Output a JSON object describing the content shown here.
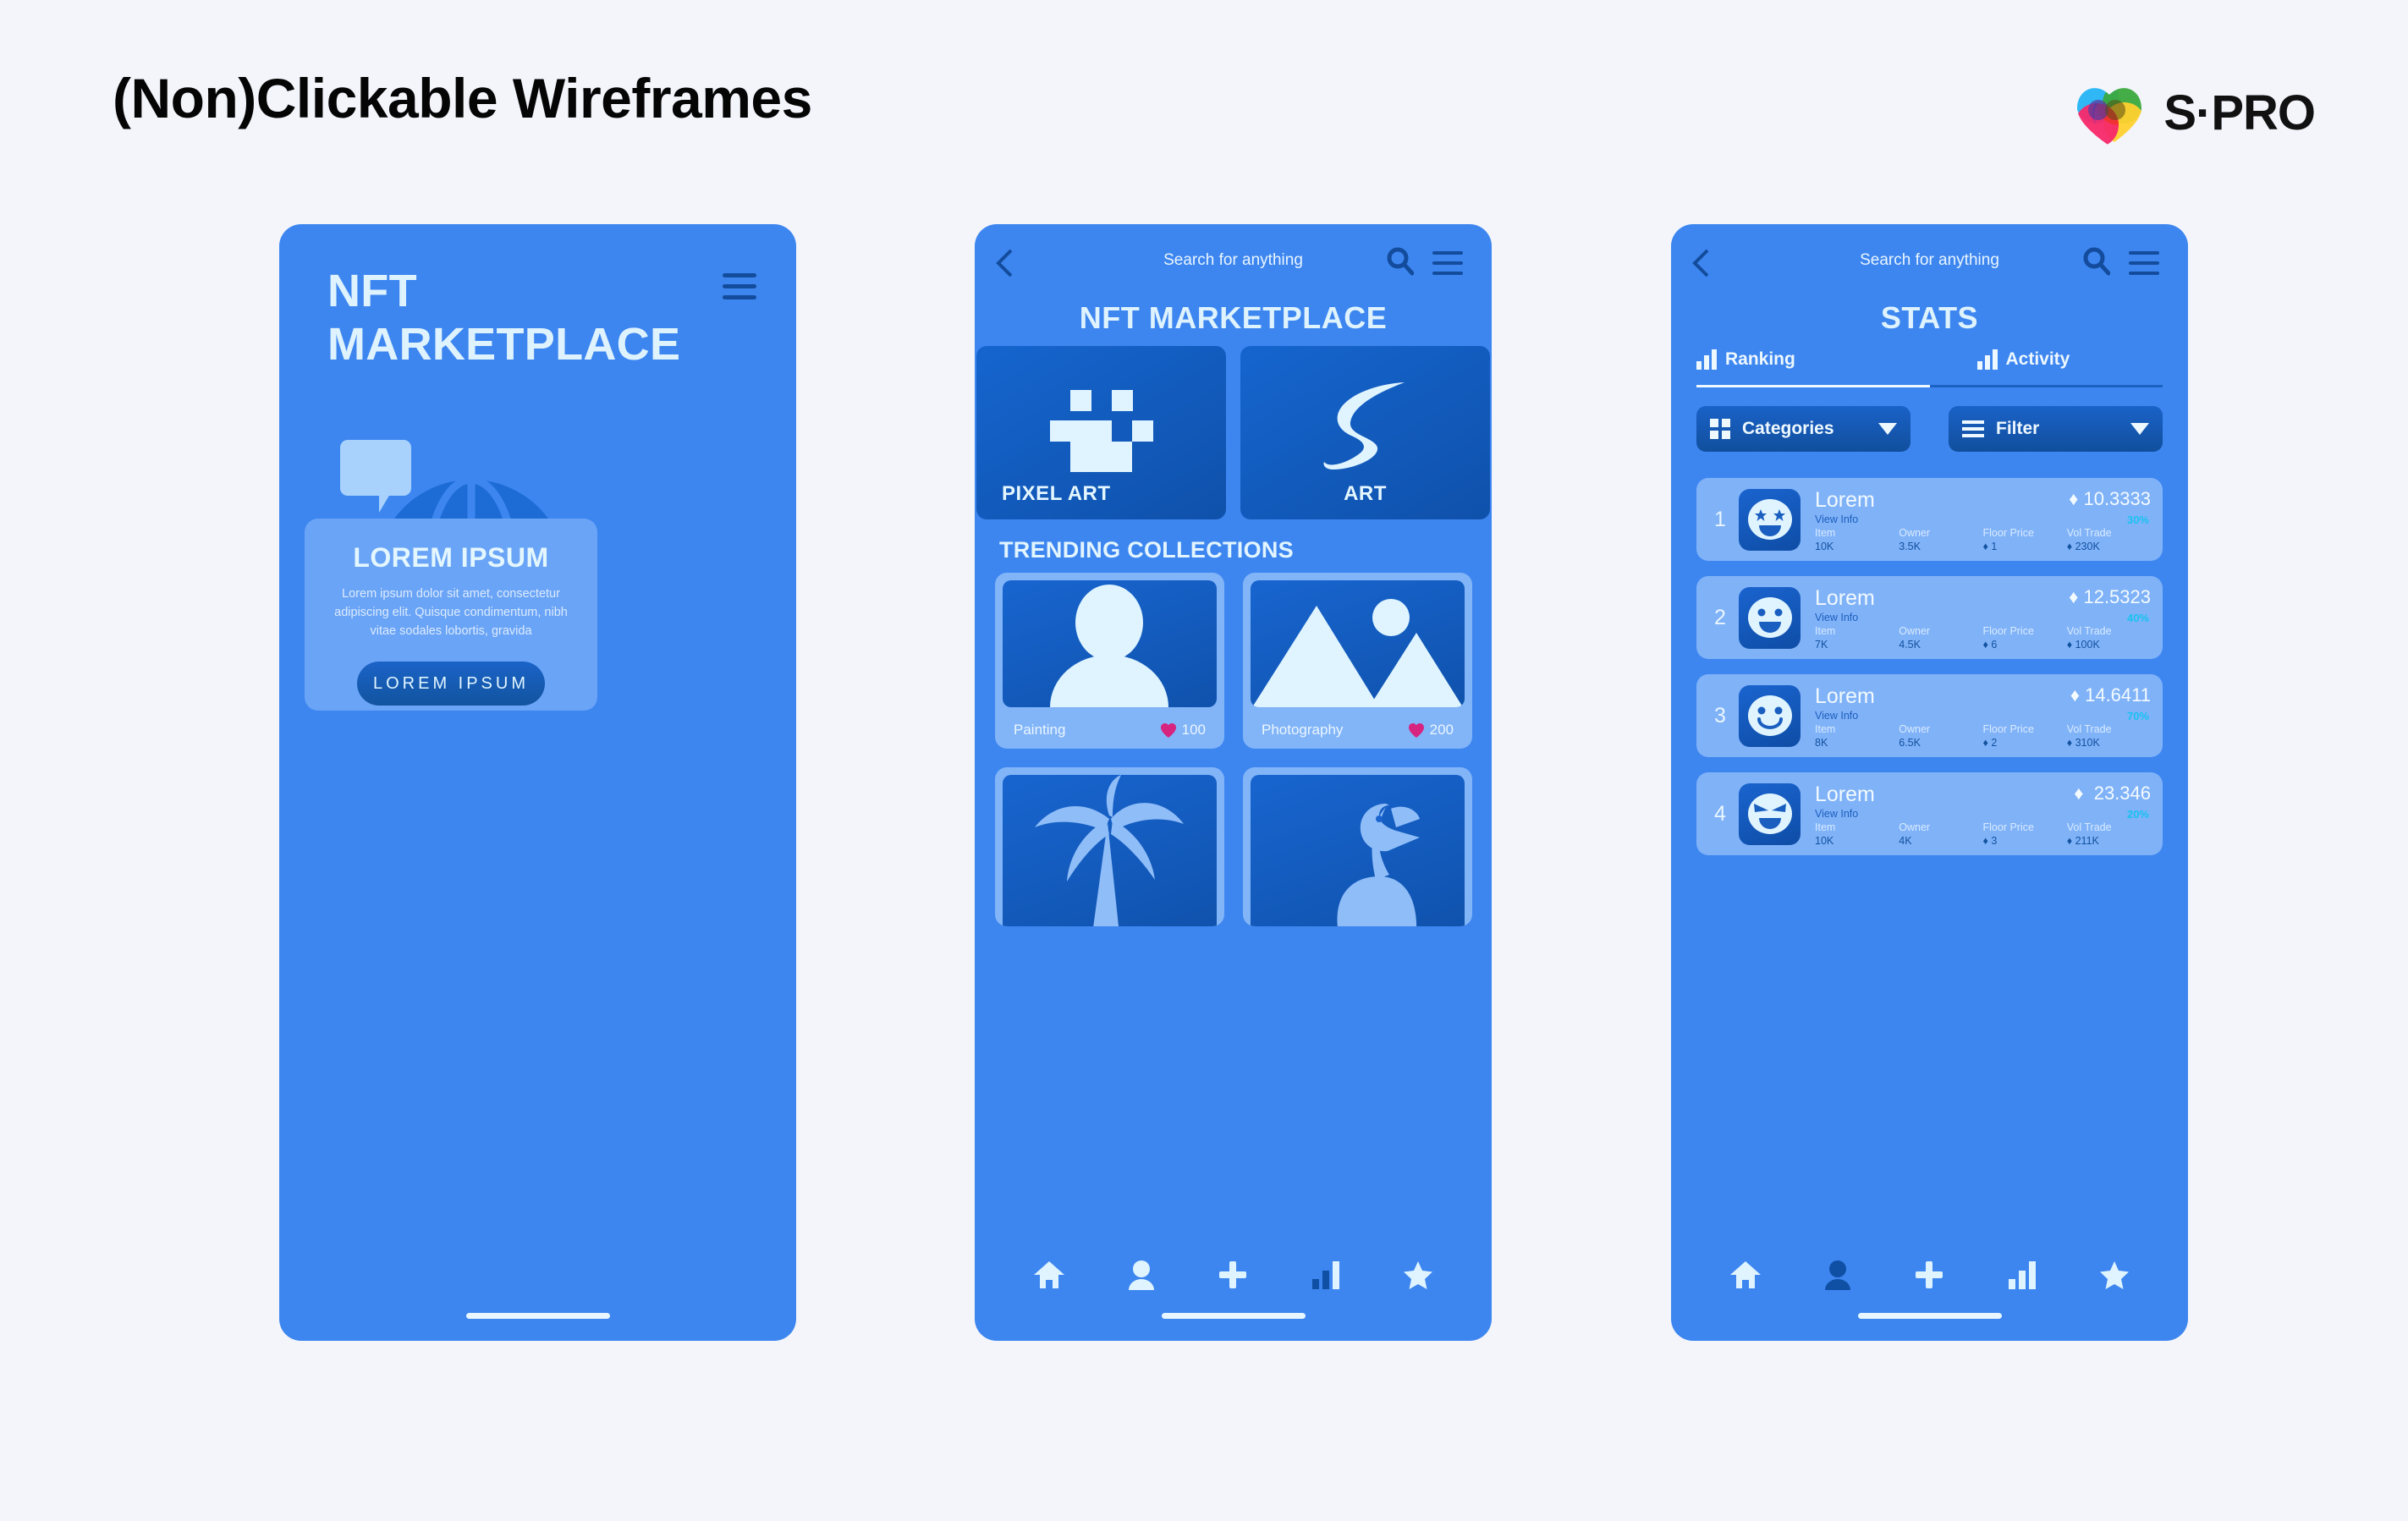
{
  "header": {
    "title": "(Non)Clickable Wireframes",
    "brand_name": "S·PRO",
    "brand_colors": {
      "blue": "#2fb8f5",
      "green": "#3aa93d",
      "yellow": "#ffd12e",
      "pink": "#f7286a",
      "red": "#f0322a",
      "purple": "#5b3a9b"
    }
  },
  "theme": {
    "page_bg": "#f4f5fb",
    "phone_bg": "#3d86f0",
    "tile_dark": "#1565cf",
    "text_light": "#dff3fe",
    "accent_dark": "#12529f",
    "accent_cyan": "#18c2f0",
    "heart_pink": "#d6247f"
  },
  "screen1": {
    "title_line1": "NFT",
    "title_line2": "MARKETPLACE",
    "menu_icon": "hamburger-icon",
    "globe_icon": "globe-icon",
    "bubble_icon": "speech-bubble-icon",
    "photo_icon": "image-tag-icon",
    "card": {
      "title": "LOREM IPSUM",
      "body": "Lorem ipsum dolor sit amet, consectetur adipiscing elit. Quisque condimentum, nibh vitae sodales lobortis, gravida",
      "cta_label": "LOREM IPSUM"
    }
  },
  "screen2": {
    "search_placeholder": "Search for anything",
    "back_icon": "chevron-left-icon",
    "search_icon": "search-icon",
    "menu_icon": "hamburger-icon",
    "title": "NFT MARKETPLACE",
    "categories": [
      {
        "label": "PIXEL ART",
        "icon": "pixel-face-icon"
      },
      {
        "label": "ART",
        "icon": "s-swirl-icon"
      }
    ],
    "section_title": "TRENDING COLLECTIONS",
    "collections": [
      {
        "label": "Painting",
        "likes": "100",
        "icon": "person-avatar-icon"
      },
      {
        "label": "Photography",
        "likes": "200",
        "icon": "mountain-image-icon"
      },
      {
        "label": "",
        "likes": "",
        "icon": "palm-tree-icon"
      },
      {
        "label": "",
        "likes": "",
        "icon": "flamingo-icon"
      }
    ],
    "nav": [
      {
        "icon": "home-icon",
        "active": false
      },
      {
        "icon": "person-icon",
        "active": false
      },
      {
        "icon": "plus-icon",
        "active": false
      },
      {
        "icon": "bar-chart-icon",
        "active": true
      },
      {
        "icon": "star-icon",
        "active": false
      }
    ]
  },
  "screen3": {
    "search_placeholder": "Search for anything",
    "back_icon": "chevron-left-icon",
    "search_icon": "search-icon",
    "menu_icon": "hamburger-icon",
    "title": "STATS",
    "tabs": [
      {
        "label": "Ranking",
        "icon": "bar-chart-icon",
        "active": true
      },
      {
        "label": "Activity",
        "icon": "bar-chart-icon",
        "active": false
      }
    ],
    "controls": [
      {
        "label": "Categories",
        "icon": "grid-icon",
        "caret": "chevron-down-icon"
      },
      {
        "label": "Filter",
        "icon": "lines-icon",
        "caret": "chevron-down-icon"
      }
    ],
    "stat_headers": [
      "Item",
      "Owner",
      "Floor Price",
      "Vol Trade"
    ],
    "rows": [
      {
        "rank": "1",
        "name": "Lorem",
        "view_info": "View Info",
        "price": "10.3333",
        "change": "30%",
        "avatar": "star-eyes-emoji",
        "item": "10K",
        "owner": "3.5K",
        "floor_price": "1",
        "vol_trade": "230K"
      },
      {
        "rank": "2",
        "name": "Lorem",
        "view_info": "View Info",
        "price": "12.5323",
        "change": "40%",
        "avatar": "smiley-open-emoji",
        "item": "7K",
        "owner": "4.5K",
        "floor_price": "6",
        "vol_trade": "100K"
      },
      {
        "rank": "3",
        "name": "Lorem",
        "view_info": "View Info",
        "price": "14.6411",
        "change": "70%",
        "avatar": "smiley-closed-emoji",
        "item": "8K",
        "owner": "6.5K",
        "floor_price": "2",
        "vol_trade": "310K"
      },
      {
        "rank": "4",
        "name": "Lorem",
        "view_info": "View Info",
        "price": "23.346",
        "change": "20%",
        "avatar": "devious-emoji",
        "item": "10K",
        "owner": "4K",
        "floor_price": "3",
        "vol_trade": "211K"
      }
    ],
    "nav": [
      {
        "icon": "home-icon",
        "active": false
      },
      {
        "icon": "person-icon",
        "active": true
      },
      {
        "icon": "plus-icon",
        "active": false
      },
      {
        "icon": "bar-chart-icon",
        "active": false
      },
      {
        "icon": "star-icon",
        "active": false
      }
    ]
  }
}
